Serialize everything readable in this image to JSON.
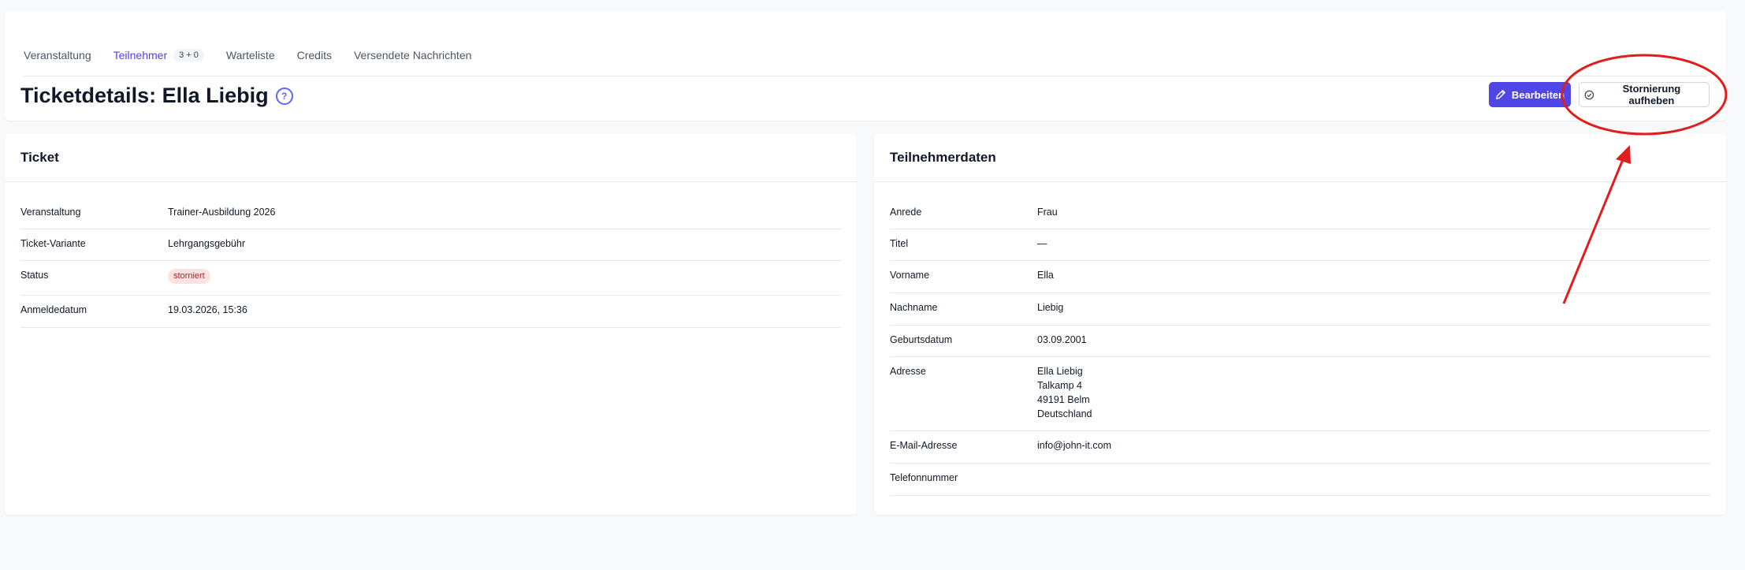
{
  "tabs": [
    {
      "label": "Veranstaltung"
    },
    {
      "label": "Teilnehmer",
      "badge": "3 + 0",
      "active": true
    },
    {
      "label": "Warteliste"
    },
    {
      "label": "Credits"
    },
    {
      "label": "Versendete Nachrichten"
    }
  ],
  "page": {
    "title": "Ticketdetails: Ella Liebig",
    "help_icon": "question-circle-icon"
  },
  "actions": {
    "edit_label": "Bearbeiten",
    "restore_label": "Stornierung aufheben"
  },
  "ticket": {
    "title": "Ticket",
    "rows": [
      {
        "label": "Veranstaltung",
        "value": "Trainer-Ausbildung 2026"
      },
      {
        "label": "Ticket-Variante",
        "value": "Lehrgangsgebühr"
      },
      {
        "label": "Status",
        "value": "storniert"
      },
      {
        "label": "Anmeldedatum",
        "value": "19.03.2026, 15:36"
      }
    ]
  },
  "participant": {
    "title": "Teilnehmerdaten",
    "rows": [
      {
        "label": "Anrede",
        "value": "Frau"
      },
      {
        "label": "Titel",
        "value": "—"
      },
      {
        "label": "Vorname",
        "value": "Ella"
      },
      {
        "label": "Nachname",
        "value": "Liebig"
      },
      {
        "label": "Geburtsdatum",
        "value": "03.09.2001"
      },
      {
        "label": "Adresse",
        "value": "Ella Liebig\nTalkamp 4\n49191 Belm\nDeutschland"
      },
      {
        "label": "E-Mail-Adresse",
        "value": "info@john-it.com"
      },
      {
        "label": "Telefonnummer",
        "value": ""
      }
    ]
  },
  "colors": {
    "accent": "#4f46e5",
    "status_cancelled_bg": "#fee2e2",
    "status_cancelled_text": "#b91c1c",
    "annotation": "#e11d1d"
  }
}
